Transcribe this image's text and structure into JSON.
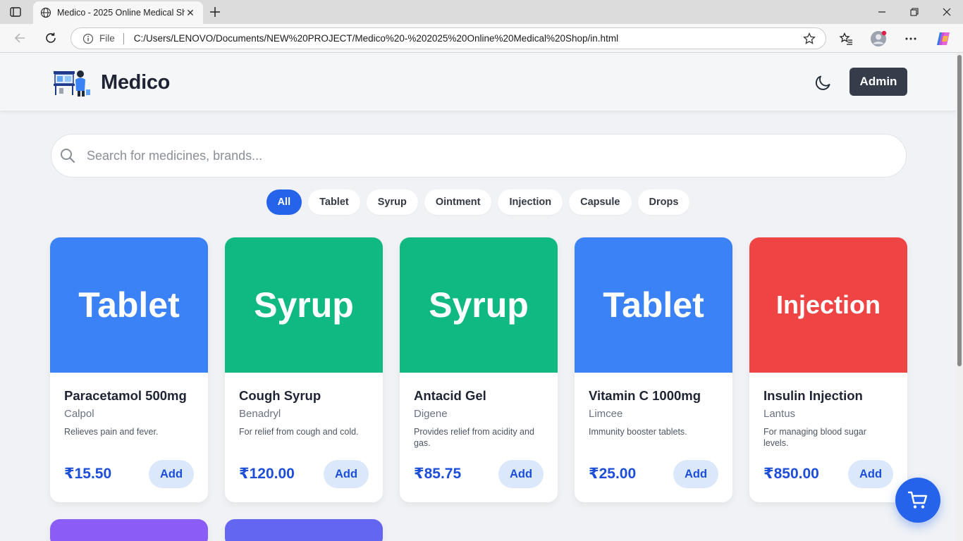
{
  "browser": {
    "tab_title": "Medico - 2025 Online Medical Sh",
    "file_label": "File",
    "url": "C:/Users/LENOVO/Documents/NEW%20PROJECT/Medico%20-%202025%20Online%20Medical%20Shop/in.html"
  },
  "header": {
    "brand": "Medico",
    "admin_label": "Admin"
  },
  "search": {
    "placeholder": "Search for medicines, brands..."
  },
  "filters": [
    "All",
    "Tablet",
    "Syrup",
    "Ointment",
    "Injection",
    "Capsule",
    "Drops"
  ],
  "active_filter": "All",
  "products": [
    {
      "banner": "Tablet",
      "color": "#3b82f6",
      "name": "Paracetamol 500mg",
      "brand": "Calpol",
      "desc": "Relieves pain and fever.",
      "price": "₹15.50",
      "add": "Add"
    },
    {
      "banner": "Syrup",
      "color": "#10b981",
      "name": "Cough Syrup",
      "brand": "Benadryl",
      "desc": "For relief from cough and cold.",
      "price": "₹120.00",
      "add": "Add"
    },
    {
      "banner": "Syrup",
      "color": "#10b981",
      "name": "Antacid Gel",
      "brand": "Digene",
      "desc": "Provides relief from acidity and gas.",
      "price": "₹85.75",
      "add": "Add"
    },
    {
      "banner": "Tablet",
      "color": "#3b82f6",
      "name": "Vitamin C 1000mg",
      "brand": "Limcee",
      "desc": "Immunity booster tablets.",
      "price": "₹25.00",
      "add": "Add"
    },
    {
      "banner": "Injection",
      "color": "#ef4444",
      "name": "Insulin Injection",
      "brand": "Lantus",
      "desc": "For managing blood sugar levels.",
      "price": "₹850.00",
      "add": "Add"
    }
  ],
  "partial_cards": [
    {
      "color": "#8b5cf6"
    },
    {
      "color": "#6366f1"
    }
  ],
  "colors": {
    "accent": "#2563eb",
    "admin_bg": "#353d4b"
  }
}
